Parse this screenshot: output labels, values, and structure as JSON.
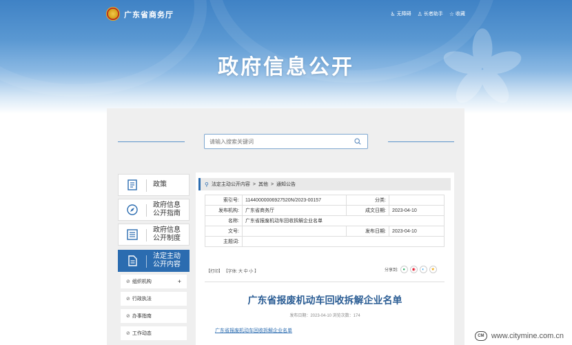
{
  "header": {
    "site_name": "广东省商务厅",
    "links": [
      {
        "icon": "accessibility-icon",
        "label": "无障碍"
      },
      {
        "icon": "elderly-icon",
        "label": "长者助手"
      },
      {
        "icon": "star-icon",
        "label": "收藏"
      }
    ],
    "banner_title": "政府信息公开"
  },
  "search": {
    "placeholder": "请输入搜索关键词"
  },
  "nav": [
    {
      "icon": "document-stack-icon",
      "label": "政策"
    },
    {
      "icon": "compass-icon",
      "label": "政府信息公开指南"
    },
    {
      "icon": "list-icon",
      "label": "政府信息公开制度"
    },
    {
      "icon": "file-icon",
      "label": "法定主动公开内容"
    }
  ],
  "subnav": [
    {
      "label": "组织机构",
      "plus": "+"
    },
    {
      "label": "行政执法"
    },
    {
      "label": "办事指南"
    },
    {
      "label": "工作动态"
    }
  ],
  "breadcrumb": {
    "items": [
      "法定主动公开内容",
      "其他",
      "通知公告"
    ],
    "sep": ">"
  },
  "meta": {
    "index_label": "索引号:",
    "index_value": "11440000006927520N/2023-00157",
    "category_label": "分类:",
    "category_value": "",
    "issuer_label": "发布机构:",
    "issuer_value": "广东省商务厅",
    "created_label": "成文日期:",
    "created_value": "2023-04-10",
    "name_label": "名称:",
    "name_value": "广东省报废机动车回收拆解企业名单",
    "docno_label": "文号:",
    "docno_value": "",
    "published_label": "发布日期:",
    "published_value": "2023-04-10",
    "subject_label": "主题词:",
    "subject_value": ""
  },
  "tools": {
    "print": "【打印】",
    "font": "【字体:",
    "large": "大",
    "medium": "中",
    "small": "小",
    "close": "】"
  },
  "share_label": "分享到:",
  "document": {
    "title": "广东省报废机动车回收拆解企业名单",
    "publish_info": "发布日期：2023-04-10  浏览次数：174",
    "attachment": "广东省报废机动车回收拆解企业名单"
  },
  "watermark": {
    "logo": "CM",
    "text": "www.citymine.com.cn"
  }
}
